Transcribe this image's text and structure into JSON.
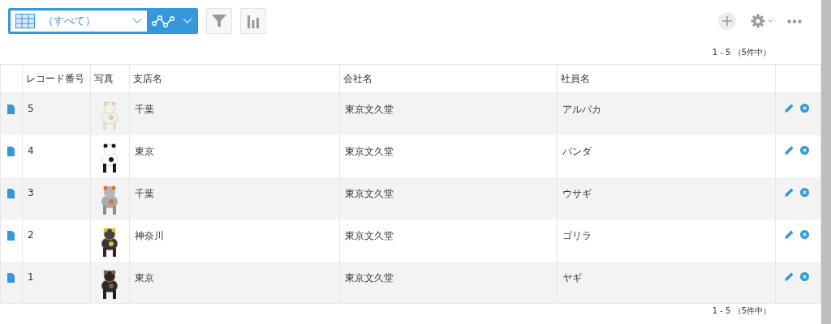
{
  "toolbar": {
    "view": "（すべて）"
  },
  "pager_top": "1 - 5 （5件中）",
  "table": {
    "columns": [
      "レコード番号",
      "写真",
      "支店名",
      "会社名",
      "社員名"
    ],
    "rows": [
      {
        "number": "5",
        "branch": "千葉",
        "company": "東京文久堂",
        "employee": "アルパカ"
      },
      {
        "number": "4",
        "branch": "東京",
        "company": "東京文久堂",
        "employee": "パンダ"
      },
      {
        "number": "3",
        "branch": "千葉",
        "company": "東京文久堂",
        "employee": "ウサギ"
      },
      {
        "number": "2",
        "branch": "神奈川",
        "company": "東京文久堂",
        "employee": "ゴリラ"
      },
      {
        "number": "1",
        "branch": "東京",
        "company": "東京文久堂",
        "employee": "ヤギ"
      }
    ]
  },
  "pager_bottom": "1 - 5 （5件中）"
}
